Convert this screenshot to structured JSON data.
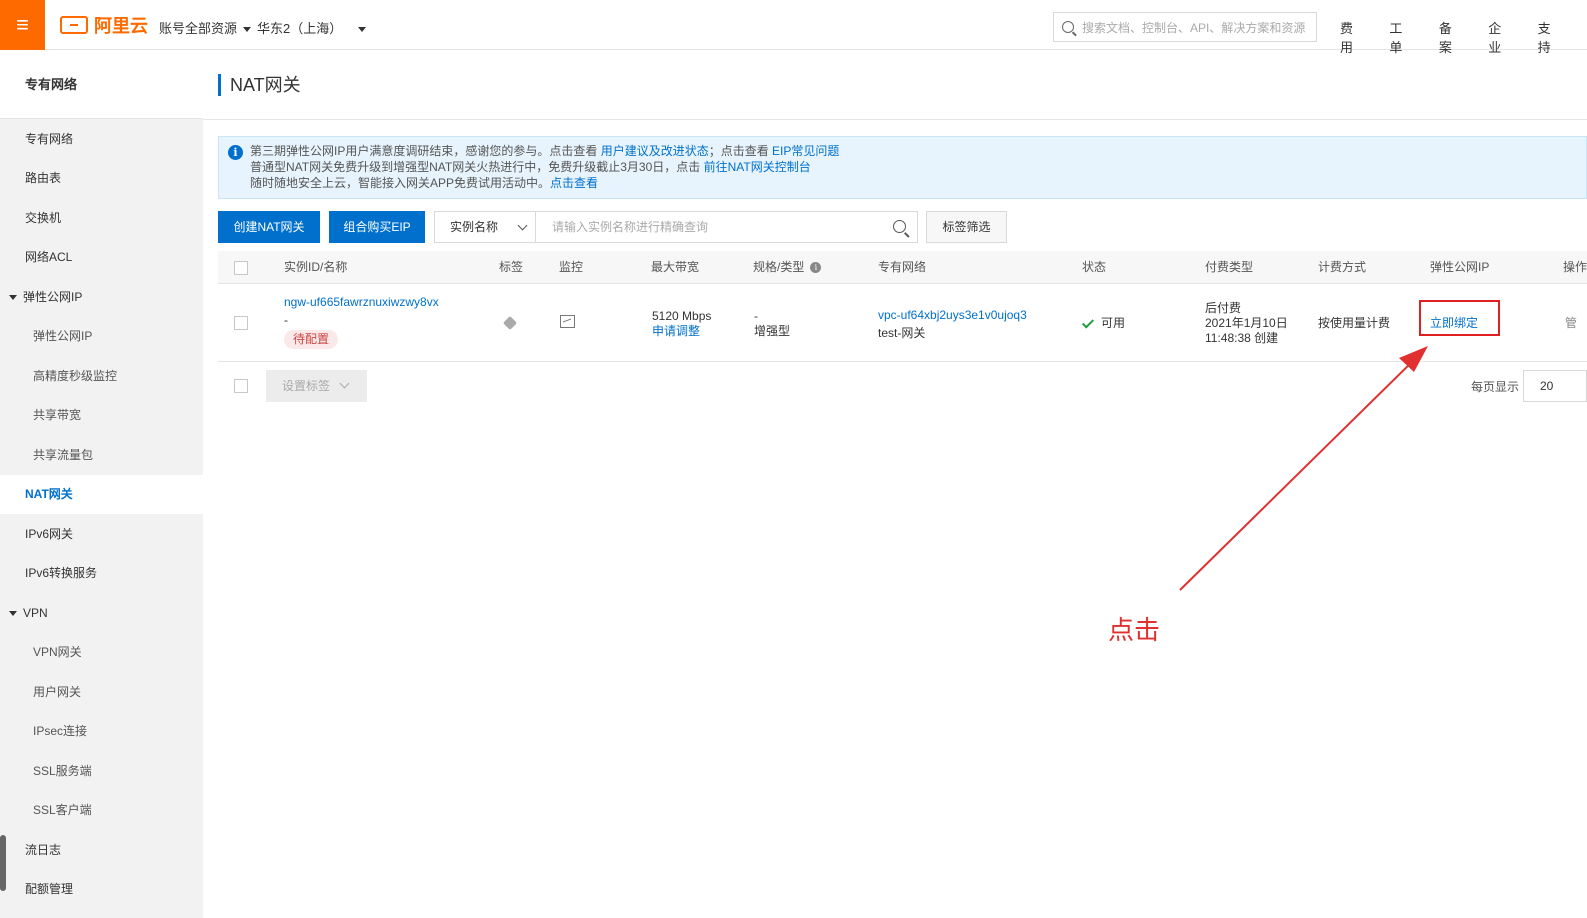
{
  "topbar": {
    "menu_icon": "≡",
    "logo_text": "阿里云",
    "account_dd": "账号全部资源",
    "region_dd": "华东2（上海）",
    "search_placeholder": "搜索文档、控制台、API、解决方案和资源",
    "links": [
      "费用",
      "工单",
      "备案",
      "企业",
      "支持"
    ]
  },
  "sidebar": {
    "title": "专有网络",
    "items": [
      {
        "label": "专有网络",
        "kind": "item"
      },
      {
        "label": "路由表",
        "kind": "item"
      },
      {
        "label": "交换机",
        "kind": "item"
      },
      {
        "label": "网络ACL",
        "kind": "item"
      },
      {
        "label": "弹性公网IP",
        "kind": "group"
      },
      {
        "label": "弹性公网IP",
        "kind": "sub"
      },
      {
        "label": "高精度秒级监控",
        "kind": "sub"
      },
      {
        "label": "共享带宽",
        "kind": "sub"
      },
      {
        "label": "共享流量包",
        "kind": "sub"
      },
      {
        "label": "NAT网关",
        "kind": "active"
      },
      {
        "label": "IPv6网关",
        "kind": "item"
      },
      {
        "label": "IPv6转换服务",
        "kind": "item"
      },
      {
        "label": "VPN",
        "kind": "group"
      },
      {
        "label": "VPN网关",
        "kind": "sub"
      },
      {
        "label": "用户网关",
        "kind": "sub"
      },
      {
        "label": "IPsec连接",
        "kind": "sub"
      },
      {
        "label": "SSL服务端",
        "kind": "sub"
      },
      {
        "label": "SSL客户端",
        "kind": "sub"
      },
      {
        "label": "流日志",
        "kind": "item"
      },
      {
        "label": "配额管理",
        "kind": "item"
      }
    ]
  },
  "main": {
    "title": "NAT网关",
    "notice": {
      "line1_text": "第三期弹性公网IP用户满意度调研结束，感谢您的参与。点击查看 ",
      "line1_link1": "用户建议及改进状态",
      "line1_mid": "；点击查看 ",
      "line1_link2": "EIP常见问题",
      "line2_text": "普通型NAT网关免费升级到增强型NAT网关火热进行中，免费升级截止3月30日，点击 ",
      "line2_link": "前往NAT网关控制台",
      "line3_text": "随时随地安全上云，智能接入网关APP免费试用活动中。",
      "line3_link": "点击查看"
    },
    "toolbar": {
      "create_btn": "创建NAT网关",
      "buy_btn": "组合购买EIP",
      "filter_select": "实例名称",
      "query_placeholder": "请输入实例名称进行精确查询",
      "tag_filter_btn": "标签筛选"
    },
    "table": {
      "headers": [
        "实例ID/名称",
        "标签",
        "监控",
        "最大带宽",
        "规格/类型",
        "专有网络",
        "状态",
        "付费类型",
        "计费方式",
        "弹性公网IP",
        "操作"
      ],
      "row": {
        "id": "ngw-uf665fawrznuxiwzwy8vx",
        "name": "-",
        "badge": "待配置",
        "bandwidth": "5120 Mbps",
        "bandwidth_link": "申请调整",
        "spec": "-",
        "type": "增强型",
        "vpc_id": "vpc-uf64xbj2uys3e1v0ujoq3",
        "vpc_name": "test-网关",
        "status": "可用",
        "pay_type": "后付费",
        "created_date": "2021年1月10日",
        "created_time": "11:48:38 创建",
        "billing": "按使用量计费",
        "eip_action": "立即绑定",
        "ops_partial": "管"
      }
    },
    "footer": {
      "set_tag_btn": "设置标签",
      "page_size_label": "每页显示",
      "page_size": "20"
    }
  },
  "annotation": {
    "text": "点击",
    "color": "#e03030"
  },
  "colors": {
    "brand": "#ff6a00",
    "primary": "#0070cc",
    "success": "#1e9e3e"
  }
}
